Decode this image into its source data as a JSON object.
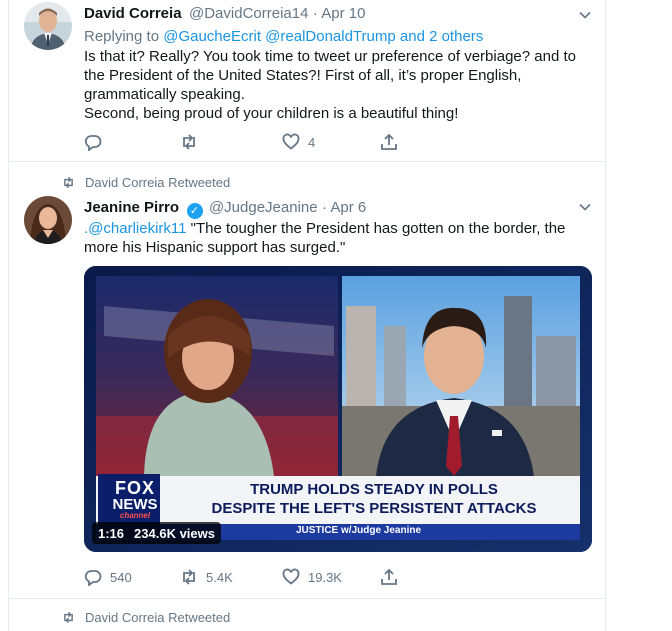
{
  "tweet1": {
    "name": "David Correia",
    "handle": "@DavidCorreia14",
    "date": "Apr 10",
    "replying_prefix": "Replying to",
    "reply_to_1": "@GaucheEcrit",
    "reply_to_2": "@realDonaldTrump",
    "reply_suffix": "and 2 others",
    "line1": "Is that it? Really? You took time to tweet ur preference of verbiage?  and to",
    "line2": "the President of the United States?! First of all, it’s proper English,",
    "line3": "grammatically speaking.",
    "line4": "Second, being proud of your children is a beautiful thing!",
    "likes": "4"
  },
  "tweet2": {
    "retweet_label": "David Correia Retweeted",
    "name": "Jeanine Pirro",
    "handle": "@JudgeJeanine",
    "date": "Apr 6",
    "mention": ".@charliekirk11",
    "line1_rest": " \"The tougher the President has gotten on the border, the",
    "line2": "more his Hispanic support has surged.\"",
    "video": {
      "headline1": "TRUMP HOLDS STEADY IN POLLS",
      "headline2": "DESPITE THE LEFT'S PERSISTENT ATTACKS",
      "show": "JUSTICE w/Judge Jeanine",
      "logo_line1": "FOX",
      "logo_line2": "NEWS",
      "logo_line3": "channel",
      "duration": "1:16",
      "views": "234.6K views"
    },
    "replies": "540",
    "retweets": "5.4K",
    "likes": "19.3K"
  },
  "tweet3": {
    "retweet_label": "David Correia Retweeted"
  },
  "colors": {
    "link": "#1b95e0",
    "muted": "#657786",
    "verified": "#1da1f2",
    "border": "#e6ecf0"
  }
}
